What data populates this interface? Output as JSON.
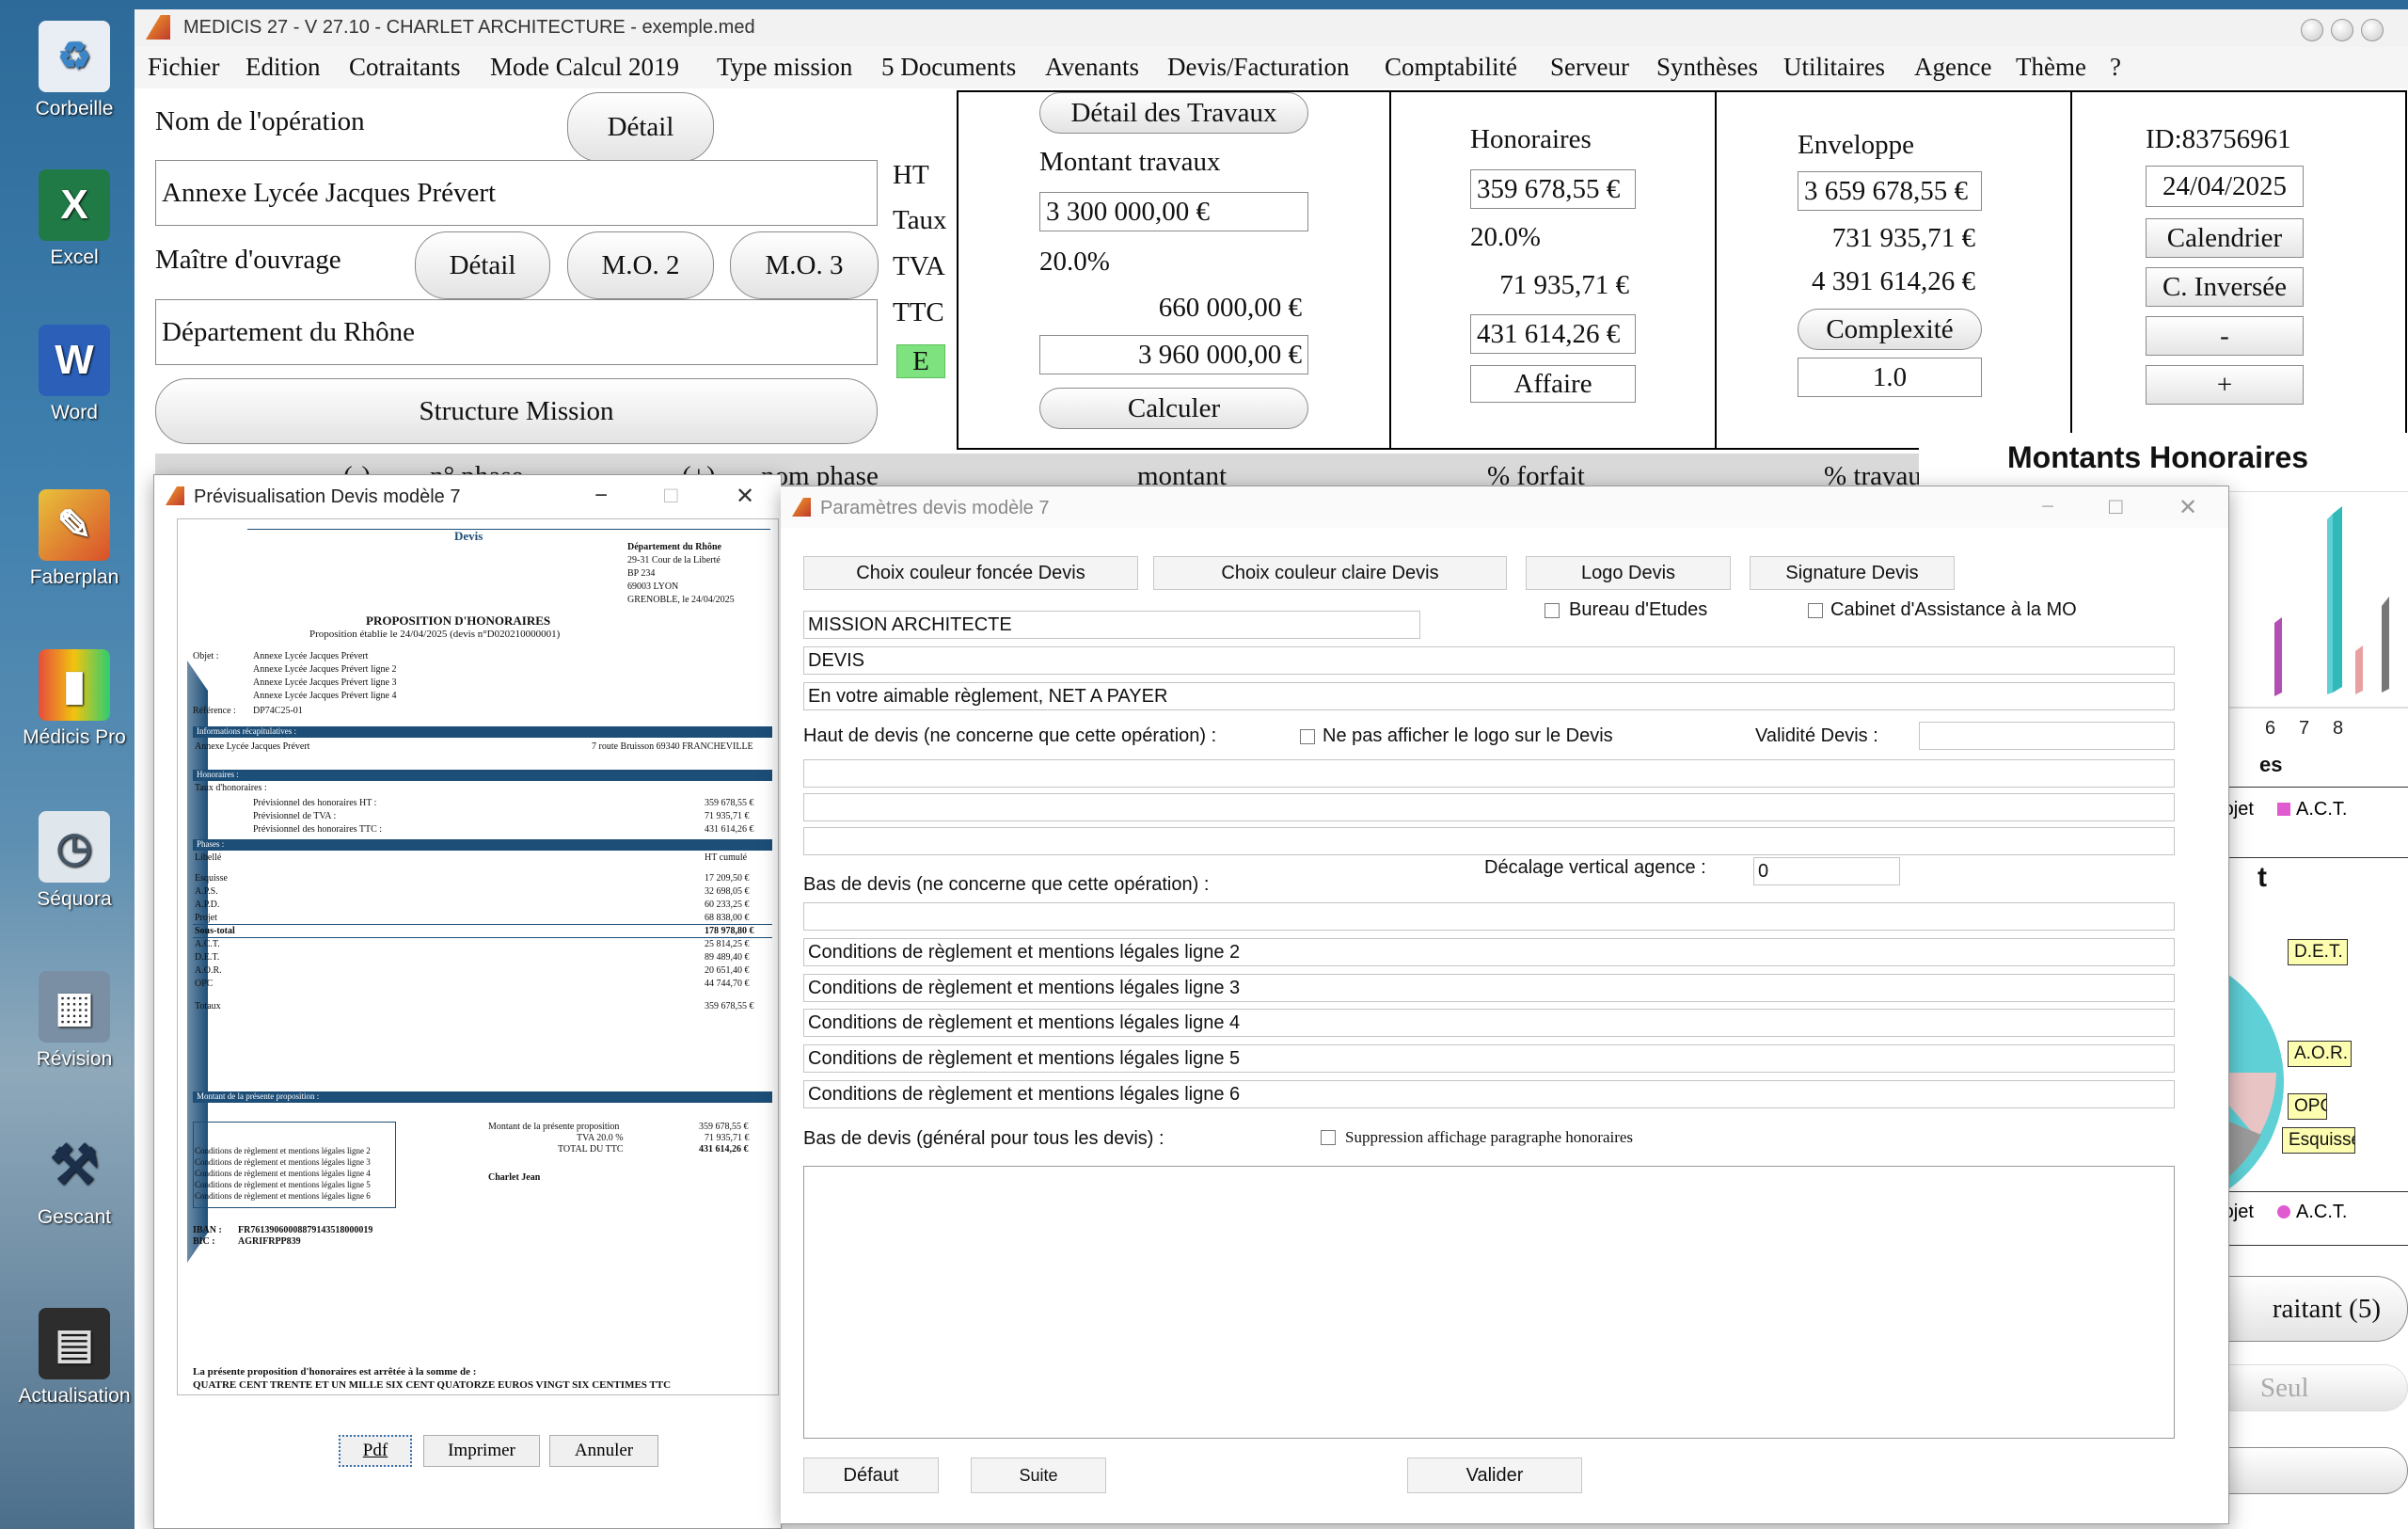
{
  "desktop": {
    "icons": [
      {
        "label": "Corbeille",
        "icon": "recycle-bin-icon"
      },
      {
        "label": "Excel",
        "icon": "excel-icon"
      },
      {
        "label": "Word",
        "icon": "word-icon"
      },
      {
        "label": "Faberplan",
        "icon": "faberplan-icon"
      },
      {
        "label": "Médicis Pro",
        "icon": "medicis-pro-icon"
      },
      {
        "label": "Séquora",
        "icon": "sequora-icon"
      },
      {
        "label": "Révision",
        "icon": "revision-icon"
      },
      {
        "label": "Gescant",
        "icon": "gescant-icon"
      },
      {
        "label": "Actualisation",
        "icon": "actualisation-icon"
      }
    ]
  },
  "app": {
    "title": "MEDICIS 27  - V 27.10 - CHARLET ARCHITECTURE - exemple.med",
    "menu": [
      "Fichier",
      "Edition",
      "Cotraitants",
      "Mode Calcul 2019",
      "Type mission",
      "5 Documents",
      "Avenants",
      "Devis/Facturation",
      "Comptabilité",
      "Serveur",
      "Synthèses",
      "Utilitaires",
      "Agence",
      "Thème",
      "?"
    ]
  },
  "operation": {
    "name_label": "Nom de l'opération",
    "detail_button": "Détail",
    "name_value": "Annexe Lycée Jacques Prévert",
    "owner_label": "Maître d'ouvrage",
    "owner_detail_button": "Détail",
    "mo2_button": "M.O. 2",
    "mo3_button": "M.O. 3",
    "owner_value": "Département du Rhône",
    "structure_button": "Structure Mission"
  },
  "tax_labels": {
    "ht": "HT",
    "taux": "Taux",
    "tva": "TVA",
    "ttc": "TTC",
    "e": "E"
  },
  "travaux": {
    "detail_button": "Détail des Travaux",
    "label": "Montant travaux",
    "ht": "3 300 000,00 €",
    "rate": "20.0%",
    "tva": "660 000,00 €",
    "ttc": "3 960 000,00 €",
    "calc_button": "Calculer"
  },
  "honoraires": {
    "label": "Honoraires",
    "ht": "359 678,55 €",
    "rate": "20.0%",
    "tva": "71 935,71 €",
    "ttc": "431 614,26 €",
    "affaire_button": "Affaire"
  },
  "enveloppe": {
    "label": "Enveloppe",
    "ht": "3 659 678,55 €",
    "tva": "731 935,71 €",
    "ttc": "4 391 614,26 €",
    "complexite_button": "Complexité",
    "complexite_value": "1.0"
  },
  "idpanel": {
    "id": "ID:83756961",
    "date": "24/04/2025",
    "calendar_button": "Calendrier",
    "inverse_button": "C. Inversée",
    "minus_button": "-",
    "plus_button": "+"
  },
  "table_header": {
    "c1": "(-)",
    "c2": "n° phase",
    "c3": "(+)",
    "c4": "nom phase",
    "c5": "montant",
    "c6": "% forfait",
    "c7": "% travaux"
  },
  "right_panel": {
    "title": "Montants Honoraires",
    "axis_ticks": [
      "6",
      "7",
      "8"
    ],
    "legend1_partial": "es",
    "legend_items1": [
      "rojet",
      "A.C.T."
    ],
    "pie_title_partial": "t",
    "pie_labels": [
      "D.E.T.",
      "A.O.R.",
      "OPC",
      "Esquisse"
    ],
    "legend_items2": [
      "rojet",
      "A.C.T."
    ],
    "cotraitant_button": "raitant (5)",
    "seul_button": "Seul"
  },
  "preview": {
    "title": "Prévisualisation Devis modèle 7",
    "doc": {
      "heading": "Devis",
      "addr": [
        "Département du Rhône",
        "29-31 Cour de la Liberté",
        "BP 234",
        "69003 LYON",
        "GRENOBLE, le 24/04/2025"
      ],
      "prop_title": "PROPOSITION D'HONORAIRES",
      "prop_sub": "Proposition établie le 24/04/2025 (devis n°D020210000001)",
      "objet_label": "Objet :",
      "objet_lines": [
        "Annexe Lycée Jacques Prévert",
        "Annexe Lycée Jacques Prévert ligne 2",
        "Annexe Lycée Jacques Prévert ligne 3",
        "Annexe Lycée Jacques Prévert ligne 4"
      ],
      "ref_label": "Référence :",
      "ref_value": "DP74C25-01",
      "info_bar": "Informations récapitulatives :",
      "info_left": "Annexe Lycée Jacques Prévert",
      "info_right": "7 route Bruisson 69340 FRANCHEVILLE",
      "hon_bar": "Honoraires :",
      "taux_label": "Taux d'honoraires :",
      "prev_rows": [
        {
          "label": "Prévisionnel des honoraires HT :",
          "value": "359 678,55 €"
        },
        {
          "label": "Prévisionnel de TVA :",
          "value": "71 935,71 €"
        },
        {
          "label": "Prévisionnel des honoraires TTC :",
          "value": "431 614,26 €"
        }
      ],
      "phases_bar": "Phases :",
      "libelle": "Libellé",
      "ht_cumule": "HT cumulé",
      "phases": [
        {
          "label": "Esquisse",
          "value": "17 209,50 €"
        },
        {
          "label": "A.P.S.",
          "value": "32 698,05 €"
        },
        {
          "label": "A.P.D.",
          "value": "60 233,25 €"
        },
        {
          "label": "Projet",
          "value": "68 838,00 €"
        },
        {
          "label": "Sous-total",
          "value": "178 978,80 €"
        },
        {
          "label": "A.C.T.",
          "value": "25 814,25 €"
        },
        {
          "label": "D.E.T.",
          "value": "89 489,40 €"
        },
        {
          "label": "A.O.R.",
          "value": "20 651,40 €"
        },
        {
          "label": "OPC",
          "value": "44 744,70 €"
        }
      ],
      "totaux_label": "Totaux",
      "totaux_value": "359 678,55 €",
      "montant_bar": "Montant de la présente proposition :",
      "conditions": [
        "Conditions de règlement et mentions légales ligne 2",
        "Conditions de règlement et mentions légales ligne 3",
        "Conditions de règlement et mentions légales ligne 4",
        "Conditions de règlement et mentions légales ligne 5",
        "Conditions de règlement et mentions légales ligne 6"
      ],
      "amount_rows": [
        {
          "label": "Montant de la présente proposition",
          "value": "359 678,55 €"
        },
        {
          "label": "TVA 20.0 %",
          "value": "71 935,71 €"
        },
        {
          "label": "TOTAL DU TTC",
          "value": "431 614,26 €"
        }
      ],
      "signer": "Charlet Jean",
      "iban": "IBAN :",
      "iban_value": "FR76139060008879143518000019",
      "bic": "BIC :",
      "bic_value": "AGRIFRPP839",
      "arrete": "La présente proposition d'honoraires est arrêtée à la somme de :",
      "somme": "QUATRE CENT TRENTE ET UN MILLE SIX CENT QUATORZE EUROS VINGT SIX CENTIMES TTC"
    },
    "buttons": {
      "pdf": "Pdf",
      "print": "Imprimer",
      "cancel": "Annuler"
    }
  },
  "params": {
    "title": "Paramètres devis modèle 7",
    "btn_dark": "Choix couleur foncée Devis",
    "btn_light": "Choix couleur claire Devis",
    "btn_logo": "Logo Devis",
    "btn_sign": "Signature Devis",
    "mission": "MISSION ARCHITECTE",
    "cb_be": "Bureau d'Etudes",
    "cb_amo": "Cabinet d'Assistance à la MO",
    "devis": "DEVIS",
    "reglement": "En votre aimable règlement, NET A PAYER",
    "haut_label": "Haut de devis (ne concerne que cette opération) :",
    "cb_logo": "Ne pas afficher le logo sur le Devis",
    "validite_label": "Validité Devis :",
    "validite_value": "",
    "decalage_label": "Décalage vertical agence :",
    "decalage_value": "0",
    "bas_label": "Bas de devis  (ne concerne que cette opération) :",
    "conditions": [
      "Conditions de règlement et mentions légales ligne 2",
      "Conditions de règlement et mentions légales ligne 3",
      "Conditions de règlement et mentions légales ligne 4",
      "Conditions de règlement et mentions légales ligne 5",
      "Conditions de règlement et mentions légales ligne 6"
    ],
    "bas_general_label": "Bas de devis  (général pour tous les devis) :",
    "cb_suppr": "Suppression affichage paragraphe honoraires",
    "btn_defaut": "Défaut",
    "btn_suite": "Suite",
    "btn_valider": "Valider"
  },
  "colors": {
    "accent": "#1d4e78",
    "e_badge": "#7ee37e",
    "pie_cyan": "#5fd0d6",
    "legend_pink": "#e05bd0"
  }
}
